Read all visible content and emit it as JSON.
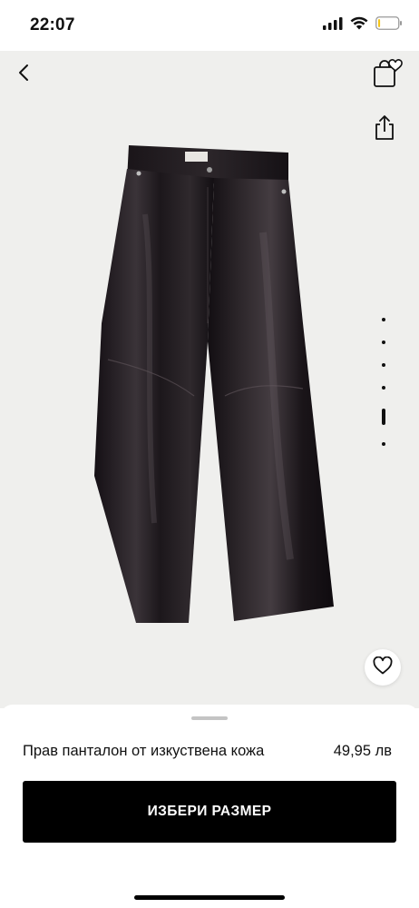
{
  "status_bar": {
    "time": "22:07",
    "signal_icon": "signal-icon",
    "wifi_icon": "wifi-icon",
    "battery_icon": "battery-low-icon",
    "battery_level": 0.1,
    "battery_color": "#f5c518"
  },
  "navigation": {
    "back_icon": "chevron-left-icon",
    "bag_wishlist_icon": "bag-heart-icon",
    "share_icon": "share-icon"
  },
  "gallery": {
    "image_count": 6,
    "active_index": 4,
    "background": "#efefed",
    "favorite_icon": "heart-outline-icon"
  },
  "product": {
    "name": "Прав панталон от изкуствена кожа",
    "price": "49,95 лв"
  },
  "actions": {
    "select_size_label": "ИЗБЕРИ РАЗМЕР"
  },
  "colors": {
    "accent": "#000000",
    "button_text": "#ffffff"
  }
}
